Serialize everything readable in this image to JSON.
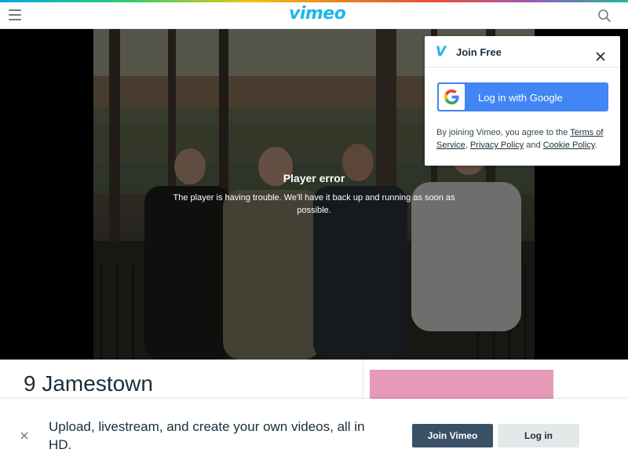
{
  "header": {
    "logo_text": "vimeo",
    "menu_icon": "hamburger-menu-icon",
    "search_icon": "search-icon",
    "accent_colors": [
      "#0aa5e6",
      "#2ecc71",
      "#f1c40f",
      "#e67e22",
      "#e74c3c",
      "#9b59b6"
    ]
  },
  "player": {
    "error_title": "Player error",
    "error_message": "The player is having trouble. We'll have it back up and running as soon as possible."
  },
  "join_card": {
    "title": "Join Free",
    "google_button": "Log in with Google",
    "terms_prefix": "By joining Vimeo, you agree to the ",
    "terms_link": "Terms of Service",
    "sep1": ", ",
    "privacy_link": "Privacy Policy",
    "sep2": " and ",
    "cookie_link": "Cookie Policy",
    "terms_suffix": "."
  },
  "video": {
    "title": "9 Jamestown"
  },
  "banner": {
    "message": "Upload, livestream, and create your own videos, all in HD.",
    "join_button": "Join Vimeo",
    "login_button": "Log in"
  },
  "colors": {
    "brand": "#1ab7ea",
    "google": "#4285f4",
    "join_button": "#395166",
    "login_button": "#e3e8e9",
    "ad_box": "#e69ab8"
  }
}
